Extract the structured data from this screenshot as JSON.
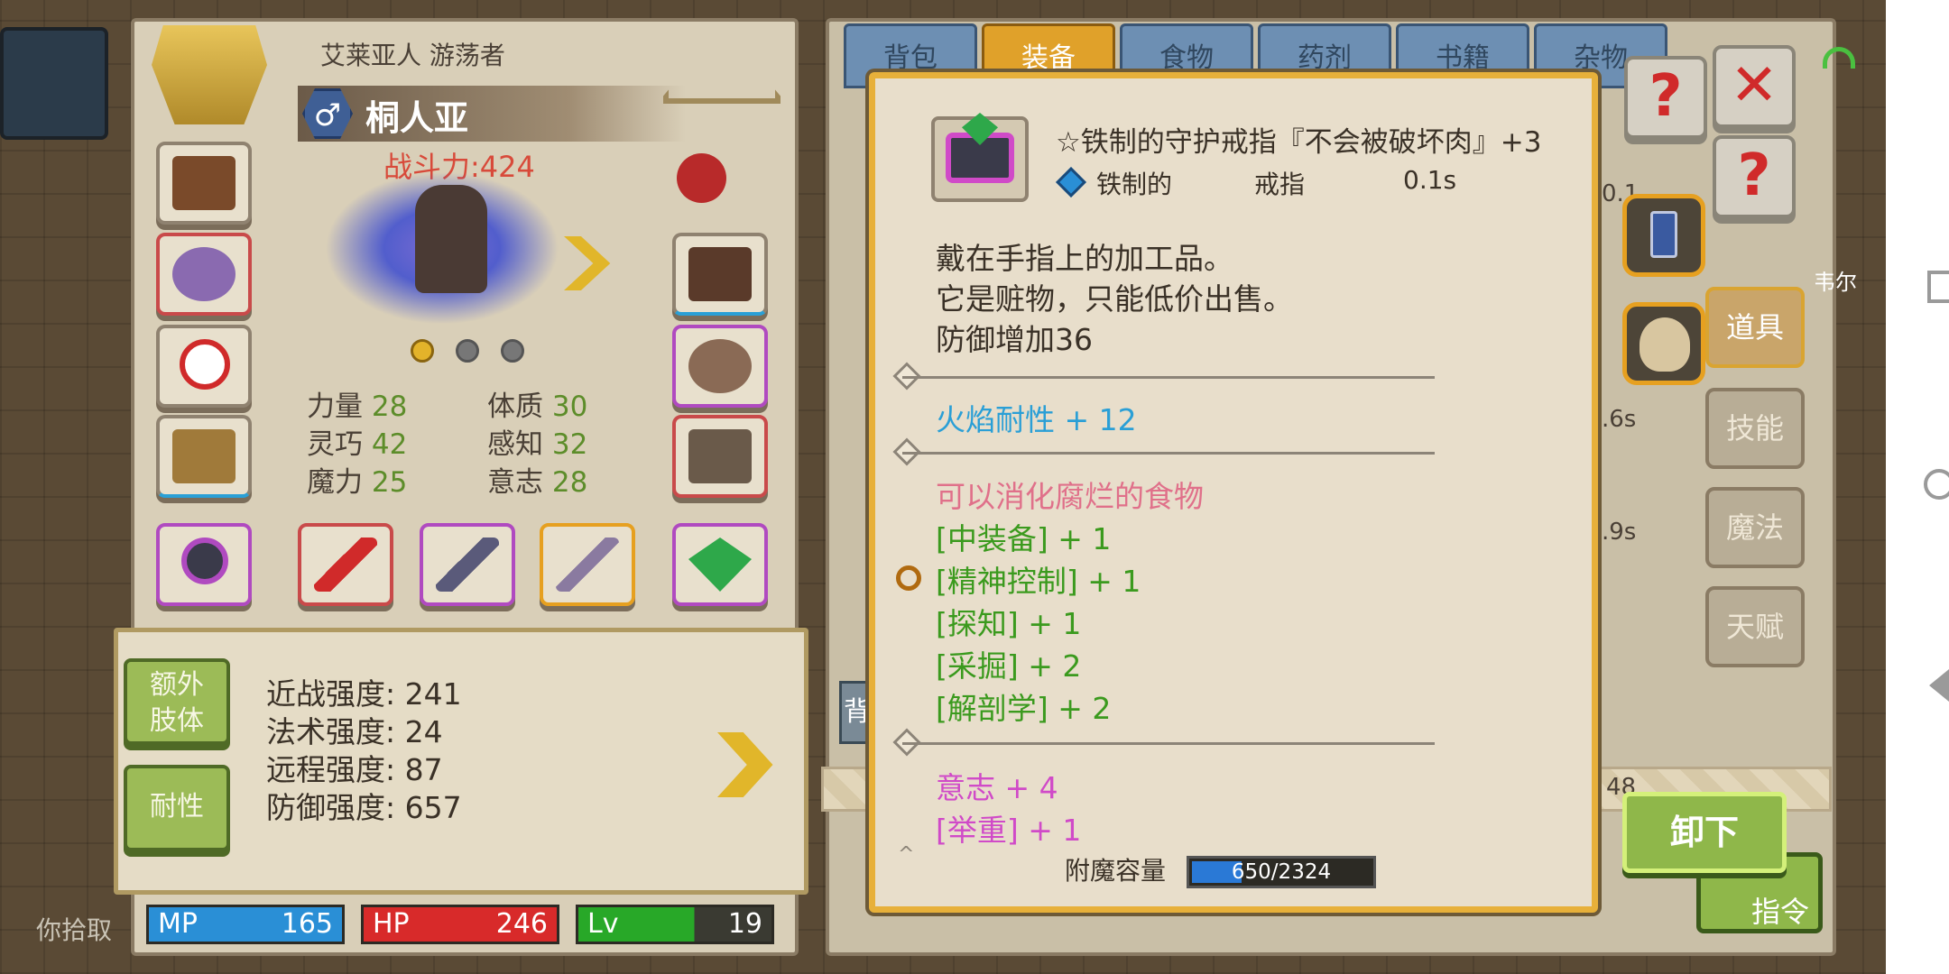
{
  "character": {
    "class_line": "艾莱亚人 游荡者",
    "name": "桐人亚",
    "gender_icon": "male-symbol",
    "power": "战斗力:424",
    "stats": [
      {
        "label": "力量",
        "value": "28"
      },
      {
        "label": "体质",
        "value": "30"
      },
      {
        "label": "灵巧",
        "value": "42"
      },
      {
        "label": "感知",
        "value": "32"
      },
      {
        "label": "魔力",
        "value": "25"
      },
      {
        "label": "意志",
        "value": "28"
      }
    ],
    "side_buttons": [
      "额外肢体",
      "耐性"
    ],
    "strengths": [
      "近战强度: 241",
      "法术强度: 24",
      "远程强度: 87",
      "防御强度: 657"
    ],
    "bars": {
      "mp_label": "MP",
      "mp": "165",
      "hp_label": "HP",
      "hp": "246",
      "lv_label": "Lv",
      "lv": "19"
    },
    "pickup_hint": "你拾取"
  },
  "inventory": {
    "tabs": [
      "背包",
      "装备",
      "食物",
      "药剂",
      "书籍",
      "杂物"
    ],
    "selected_tab": "装备",
    "right_tabs": [
      "道具",
      "技能",
      "魔法",
      "天赋"
    ],
    "selected_right_tab": "道具",
    "back_label": "背",
    "partial_texts": [
      "0.1",
      ".6s",
      ".9s",
      "48",
      "韦尔",
      "指令"
    ],
    "unequip_label": "卸下"
  },
  "tooltip": {
    "title": "☆铁制的守护戒指『不会被破坏肉』+3",
    "material": "铁制的",
    "type": "戒指",
    "time": "0.1s",
    "description": [
      "戴在手指上的加工品。",
      "它是赃物，只能低价出售。",
      "防御增加36"
    ],
    "resist": "火焰耐性 + 12",
    "special_header": "可以消化腐烂的食物",
    "skills": [
      "[中装备] + 1",
      "[精神控制] + 1",
      "[探知] + 1",
      "[采掘] + 2",
      "[解剖学] + 2"
    ],
    "attrs": [
      "意志 + 4",
      "[举重] + 1"
    ],
    "enchant_label": "附魔容量",
    "enchant_value": "650/2324",
    "enchant_fraction": 0.28
  },
  "colors": {
    "resist": "#2a9fd6",
    "special": "#e0708a",
    "skill": "#3b9a1e",
    "attr": "#d04ac8",
    "mp": "#2a8fd6",
    "hp": "#d82a2a",
    "lv": "#28a828"
  }
}
